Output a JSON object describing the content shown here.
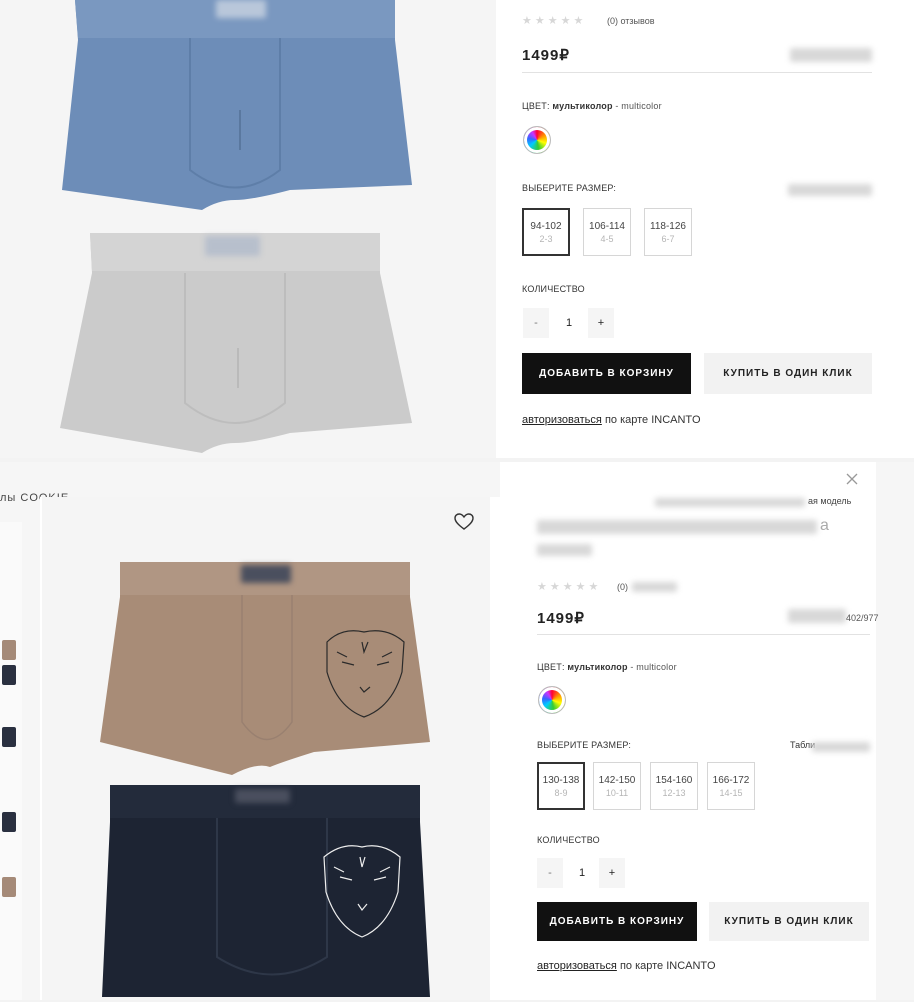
{
  "top": {
    "reviews": "(0) отзывов",
    "price": "1499₽",
    "color_label": "ЦВЕТ:",
    "color_value": "мультиколор",
    "color_extra": "- multicolor",
    "size_label": "ВЫБЕРИТЕ РАЗМЕР:",
    "sizes": [
      {
        "main": "94-102",
        "sub": "2-3"
      },
      {
        "main": "106-114",
        "sub": "4-5"
      },
      {
        "main": "118-126",
        "sub": "6-7"
      }
    ],
    "qty_label": "КОЛИЧЕСТВО",
    "qty_minus": "-",
    "qty_value": "1",
    "qty_plus": "+",
    "add_to_cart": "ДОБАВИТЬ В КОРЗИНУ",
    "one_click": "КУПИТЬ В ОДИН КЛИК",
    "auth_link": "авторизоваться",
    "auth_rest": "по карте INCANTO"
  },
  "bottom": {
    "cookie_text": "лы COOKIE",
    "breadcrumb_tail": "ая модель",
    "title_tail": "а",
    "reviews": "(0)",
    "price": "1499₽",
    "sku": "402/977",
    "color_label": "ЦВЕТ:",
    "color_value": "мультиколор",
    "color_extra": "- multicolor",
    "size_label": "ВЫБЕРИТЕ РАЗМЕР:",
    "size_table": "Табли",
    "sizes": [
      {
        "main": "130-138",
        "sub": "8-9"
      },
      {
        "main": "142-150",
        "sub": "10-11"
      },
      {
        "main": "154-160",
        "sub": "12-13"
      },
      {
        "main": "166-172",
        "sub": "14-15"
      }
    ],
    "qty_label": "КОЛИЧЕСТВО",
    "qty_minus": "-",
    "qty_value": "1",
    "qty_plus": "+",
    "add_to_cart": "ДОБАВИТЬ В КОРЗИНУ",
    "one_click": "КУПИТЬ В ОДИН КЛИК",
    "auth_link": "авторизоваться",
    "auth_rest": "по карте INCANTO"
  },
  "icons": {
    "close": "close-icon",
    "favorite": "heart-icon"
  },
  "colors": {
    "blue_trunk": "#6d8db8",
    "grey_trunk": "#cbcbcb",
    "brown_trunk": "#a88c77",
    "navy_trunk": "#1d2433",
    "button_dark": "#111111"
  }
}
